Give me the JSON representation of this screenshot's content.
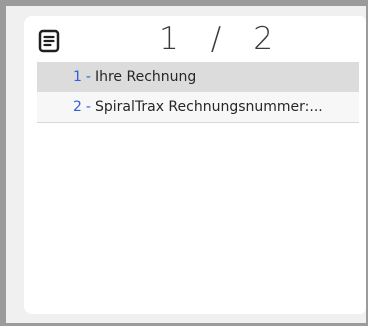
{
  "header": {
    "current_page": "1",
    "separator": "/",
    "total_pages": "2",
    "icon": "document-icon"
  },
  "documents": [
    {
      "number": "1",
      "dash": "-",
      "title": "Ihre Rechnung",
      "selected": true
    },
    {
      "number": "2",
      "dash": "-",
      "title": "SpiralTrax Rechnungsnummer:...",
      "selected": false
    }
  ],
  "colors": {
    "accent": "#2f5fe0",
    "selected_bg": "#dcdcdc",
    "outer_bg": "#9b9b9b"
  }
}
